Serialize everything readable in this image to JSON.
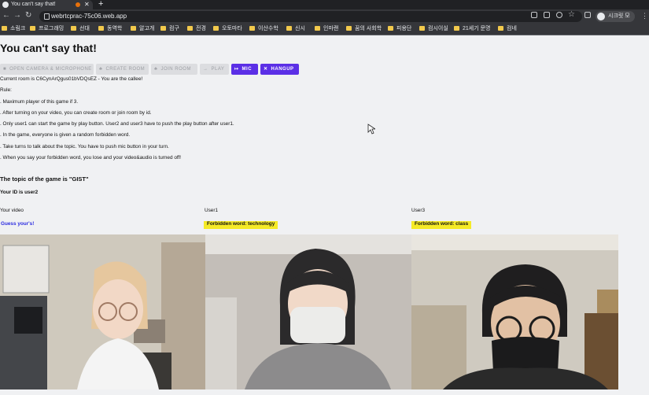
{
  "browser": {
    "tab_title": "You can't say that!",
    "url": "webrtcprac-75c06.web.app",
    "profile_label": "시크릿 모드",
    "bookmarks": [
      "소림크",
      "프로그래밍",
      "선대",
      "동역학",
      "알고개",
      "컴구",
      "전경",
      "오토마타",
      "이산수학",
      "신시",
      "인마랜",
      "꿈의 사회학",
      "피용단",
      "컴시이실",
      "21세기 문명",
      "컴네"
    ]
  },
  "page": {
    "title": "You can't say that!",
    "buttons": {
      "camera": "OPEN CAMERA & MICROPHONE",
      "create": "CREATE ROOM",
      "join": "JOIN ROOM",
      "play": "PLAY",
      "mic": "MIC",
      "hangup": "HANGUP"
    },
    "room_status": "Current room is C6CynArQgus01bVDQsEZ - You are the callee!",
    "rule_header": "Rule:",
    "rules": [
      ". Maximum player of this game if 3.",
      ". After turning on your video, you can create room or join room by id.",
      ". Only user1 can start the game by play button. User2 and user3 have to push the play button after user1.",
      ". In the game, everyone is given a random forbidden word.",
      ". Take turns to talk about the topic. You have to push mic button in your turn.",
      ". When you say your forbidden word, you lose and your video&audio is turned off!"
    ],
    "topic": "The topic of the game is \"GIST\"",
    "your_id": "Your ID is user2",
    "players": [
      {
        "label": "Your video",
        "word": "Guess your's!"
      },
      {
        "label": "User1",
        "word": "Forbidden word: technology"
      },
      {
        "label": "User3",
        "word": "Forbidden word: class"
      }
    ]
  }
}
